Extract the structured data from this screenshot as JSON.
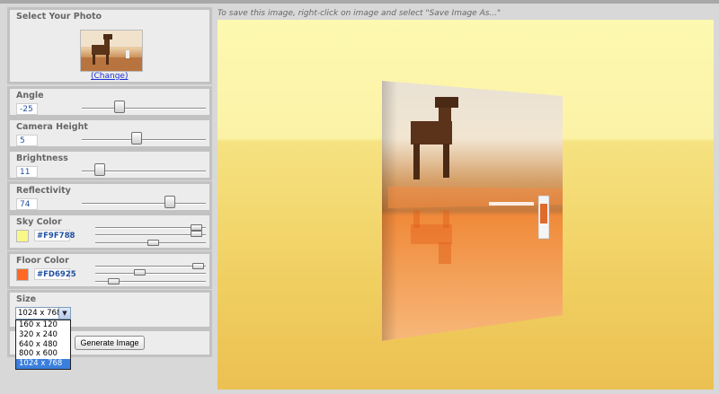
{
  "instructions": "To save this image, right-click on image and select \"Save Image As...\"",
  "select_photo": {
    "title": "Select Your Photo",
    "change_label": "(Change)"
  },
  "angle": {
    "title": "Angle",
    "value": "-25"
  },
  "camera_height": {
    "title": "Camera Height",
    "value": "5"
  },
  "brightness": {
    "title": "Brightness",
    "value": "11"
  },
  "reflectivity": {
    "title": "Reflectivity",
    "value": "74"
  },
  "sky_color": {
    "title": "Sky Color",
    "hex": "#F9F788",
    "color": "#F9F788"
  },
  "floor_color": {
    "title": "Floor Color",
    "hex": "#FD6925",
    "color": "#FD6925"
  },
  "size": {
    "title": "Size",
    "selected": "1024 x 768",
    "options": [
      "160 x 120",
      "320 x 240",
      "640 x 480",
      "800 x 600",
      "1024 x 768"
    ]
  },
  "generate_button": "Generate Image"
}
